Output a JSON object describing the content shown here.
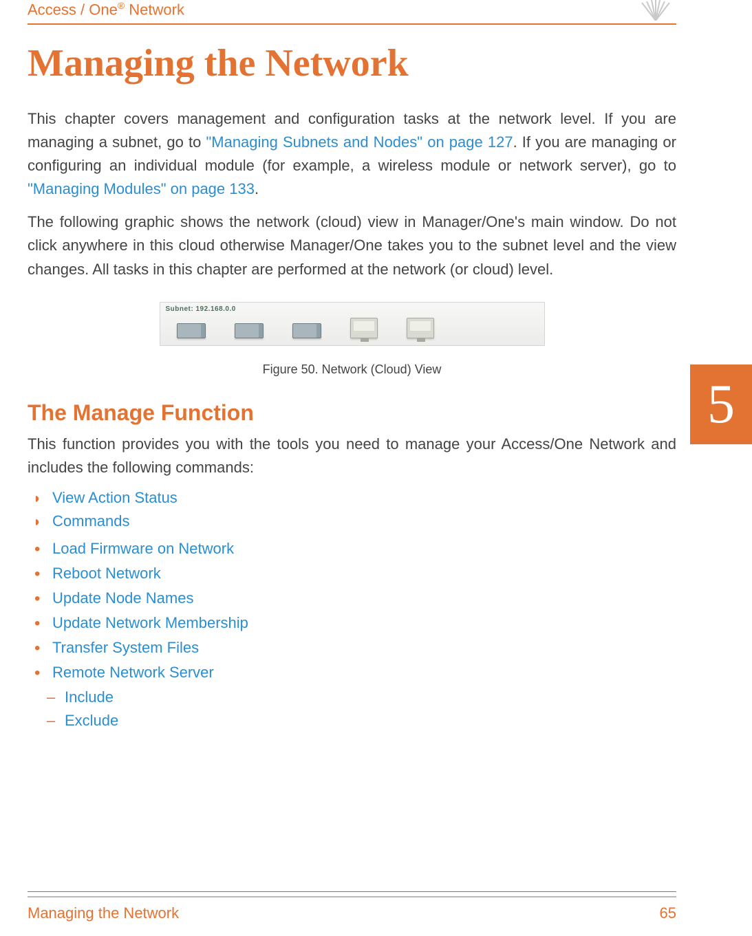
{
  "header": {
    "product_prefix": "Access / One",
    "product_suffix": " Network"
  },
  "title": "Managing the Network",
  "chapter_number": "5",
  "paragraphs": {
    "p1_pre": "This chapter covers management and configuration tasks at the network level. If you are managing a subnet, go to ",
    "p1_link1": "\"Managing Subnets and Nodes\" on page 127",
    "p1_mid": ". If you are managing or configuring an individual module (for example, a wireless module or network server), go to ",
    "p1_link2": "\"Managing Modules\" on page 133",
    "p1_post": ".",
    "p2": "The following graphic shows the network (cloud) view in Manager/One's main window. Do not click anywhere in this cloud otherwise Manager/One takes you to the subnet level and the view changes. All tasks in this chapter are performed at the network (or cloud) level."
  },
  "figure": {
    "subnet_label": "Subnet: 192.168.0.0",
    "caption": "Figure 50. Network (Cloud) View"
  },
  "section": {
    "heading": "The Manage Function",
    "intro": "This function provides you with the tools you need to manage your Access/One Network and includes the following commands:"
  },
  "list": {
    "top1": "View Action Status",
    "top2": "Commands",
    "sub1": "Load Firmware on Network",
    "sub2": "Reboot Network",
    "sub3": "Update Node Names",
    "sub4": "Update Network Membership",
    "sub5": "Transfer System Files",
    "sub6": "Remote Network Server",
    "subsub1": "Include",
    "subsub2": "Exclude"
  },
  "footer": {
    "left": "Managing the Network",
    "right": "65"
  }
}
